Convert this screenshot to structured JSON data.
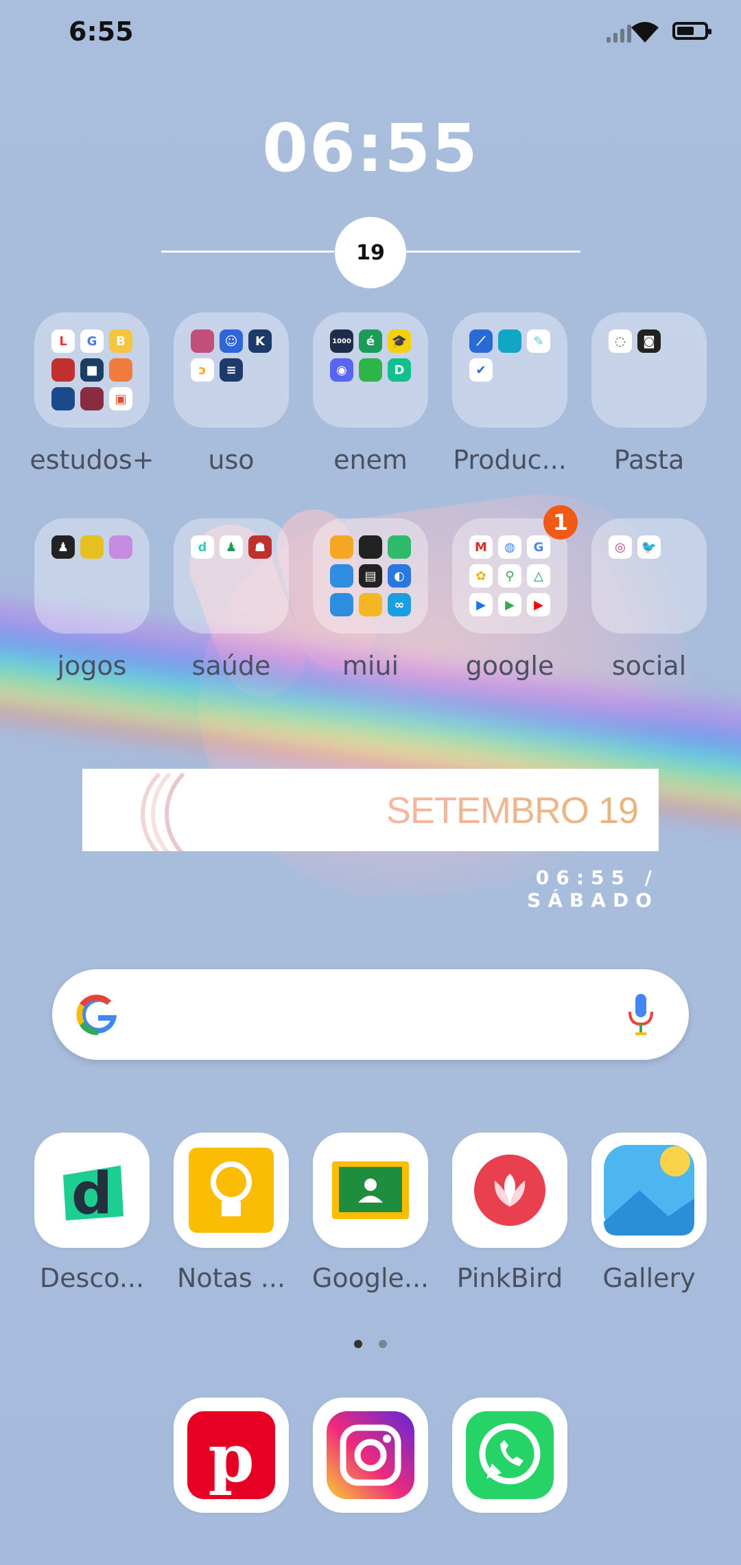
{
  "status": {
    "time": "6:55"
  },
  "clock": {
    "time": "06:55",
    "day": "19"
  },
  "folders_row1": [
    {
      "label": "estudos+"
    },
    {
      "label": "uso"
    },
    {
      "label": "enem"
    },
    {
      "label": "Produc..."
    },
    {
      "label": "Pasta"
    }
  ],
  "folders_row2": [
    {
      "label": "jogos"
    },
    {
      "label": "saúde"
    },
    {
      "label": "miui"
    },
    {
      "label": "google",
      "badge": "1"
    },
    {
      "label": "social"
    }
  ],
  "widget": {
    "title": "SETEMBRO 19",
    "subtitle": "06:55 / SÁBADO"
  },
  "search": {
    "icon": "google-g-icon",
    "mic_icon": "mic-icon"
  },
  "apps": [
    {
      "label": "Desco...",
      "icon": "descomplica-icon"
    },
    {
      "label": "Notas ...",
      "icon": "keep-notes-icon"
    },
    {
      "label": "Google...",
      "icon": "google-classroom-icon"
    },
    {
      "label": "PinkBird",
      "icon": "pinkbird-icon"
    },
    {
      "label": "Gallery",
      "icon": "gallery-icon"
    }
  ],
  "dock": [
    {
      "icon": "pinterest-icon"
    },
    {
      "icon": "instagram-icon"
    },
    {
      "icon": "whatsapp-icon"
    }
  ],
  "page_indicator": {
    "pages": 2,
    "active": 1
  }
}
